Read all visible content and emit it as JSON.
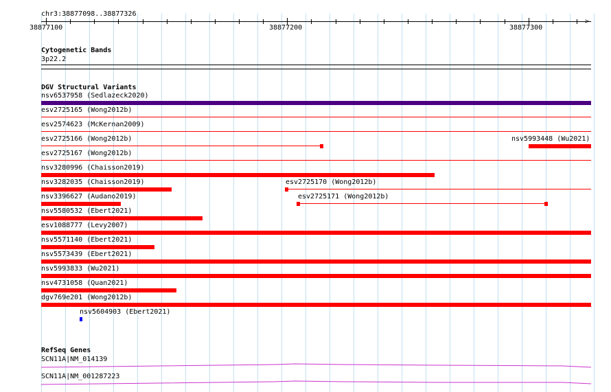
{
  "ruler": {
    "range_label": "chr3:38877098..38877326",
    "ticks": [
      "38877100",
      "38877200",
      "38877300"
    ]
  },
  "cytoband": {
    "title": "Cytogenetic Bands",
    "band": "3p22.2"
  },
  "dgv": {
    "title": "DGV Structural Variants",
    "colors": {
      "loss": "#ff0000",
      "gain": "#0000ff",
      "complex": "#4b0082"
    },
    "variants": [
      {
        "name": "nsv6537958 (Sedlazeck2020)",
        "style": "bar",
        "start": 38877098,
        "end": 38877326,
        "color": "#4b0082"
      },
      {
        "name": "esv2725165 (Wong2012b)",
        "style": "line",
        "start": 38877098,
        "end": 38877326,
        "color": "#ff0000"
      },
      {
        "name": "esv2574623 (McKernan2009)",
        "style": "line",
        "start": 38877098,
        "end": 38877326,
        "color": "#ff0000"
      },
      {
        "name": "esv2725166 (Wong2012b)",
        "style": "line-end",
        "start": 38877098,
        "end": 38877215,
        "color": "#ff0000"
      },
      {
        "name": "nsv5993448 (Wu2021)",
        "style": "bar",
        "start": 38877300,
        "end": 38877326,
        "color": "#ff0000"
      },
      {
        "name": "esv2725167 (Wong2012b)",
        "style": "line",
        "start": 38877098,
        "end": 38877326,
        "color": "#ff0000"
      },
      {
        "name": "nsv3280996 (Chaisson2019)",
        "style": "bar",
        "start": 38877098,
        "end": 38877261,
        "color": "#ff0000"
      },
      {
        "name": "nsv3282035 (Chaisson2019)",
        "style": "bar",
        "start": 38877098,
        "end": 38877152,
        "color": "#ff0000"
      },
      {
        "name": "esv2725170 (Wong2012b)",
        "style": "line-start",
        "start": 38877199,
        "end": 38877326,
        "color": "#ff0000"
      },
      {
        "name": "nsv3396627 (Audano2019)",
        "style": "bar",
        "start": 38877098,
        "end": 38877131,
        "color": "#ff0000"
      },
      {
        "name": "esv2725171 (Wong2012b)",
        "style": "line-both",
        "start": 38877204,
        "end": 38877308,
        "color": "#ff0000"
      },
      {
        "name": "nsv5580532 (Ebert2021)",
        "style": "bar",
        "start": 38877098,
        "end": 38877165,
        "color": "#ff0000"
      },
      {
        "name": "esv1088777 (Levy2007)",
        "style": "bar",
        "start": 38877098,
        "end": 38877326,
        "color": "#ff0000"
      },
      {
        "name": "nsv5571140 (Ebert2021)",
        "style": "bar",
        "start": 38877098,
        "end": 38877145,
        "color": "#ff0000"
      },
      {
        "name": "nsv5573439 (Ebert2021)",
        "style": "bar",
        "start": 38877098,
        "end": 38877326,
        "color": "#ff0000"
      },
      {
        "name": "nsv5993833 (Wu2021)",
        "style": "bar",
        "start": 38877098,
        "end": 38877326,
        "color": "#ff0000"
      },
      {
        "name": "nsv4731058 (Quan2021)",
        "style": "bar",
        "start": 38877098,
        "end": 38877154,
        "color": "#ff0000"
      },
      {
        "name": "dgv769e201 (Wong2012b)",
        "style": "bar",
        "start": 38877098,
        "end": 38877326,
        "color": "#ff0000"
      },
      {
        "name": "nsv5604903 (Ebert2021)",
        "style": "bar",
        "start": 38877114,
        "end": 38877115,
        "color": "#0000ff"
      }
    ]
  },
  "refseq": {
    "title": "RefSeq Genes",
    "color": "#cc33cc",
    "genes": [
      {
        "name": "SCN11A|NM_014139"
      },
      {
        "name": "SCN11A|NM_001287223"
      }
    ]
  }
}
